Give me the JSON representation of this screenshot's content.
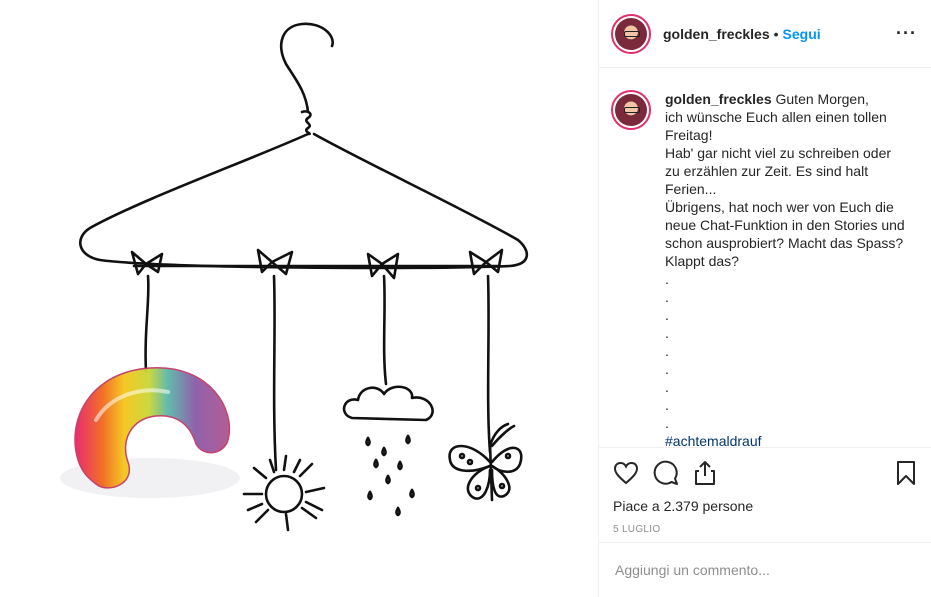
{
  "post": {
    "username": "golden_freckles",
    "separator": "•",
    "follow_label": "Segui",
    "more_label": "···",
    "caption": "Guten Morgen,\nich wünsche Euch allen einen tollen Freitag!\nHab' gar nicht viel zu schreiben oder zu erzählen zur Zeit. Es sind halt Ferien...\nÜbrigens, hat noch wer von Euch die neue Chat-Funktion in den Stories und schon ausprobiert? Macht das Spass? Klappt das?\n.\n.\n.\n.\n.\n.\n.\n.\n.",
    "hashtag": "#achtemaldrauf",
    "likes": "Piace a 2.379 persone",
    "date": "5 luglio",
    "comment_placeholder": "Aggiungi un commento..."
  },
  "icons": {
    "like": "heart-icon",
    "comment": "comment-icon",
    "share": "share-icon",
    "save": "bookmark-icon",
    "more": "more-options-icon"
  },
  "colors": {
    "follow": "#0095f6",
    "avatar_ring": "#e1306c",
    "secondary_text": "#8e8e8e"
  }
}
